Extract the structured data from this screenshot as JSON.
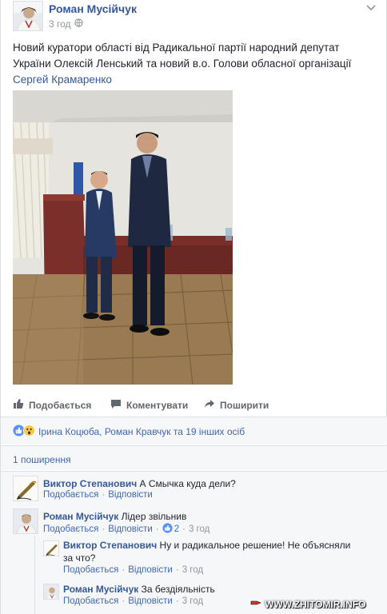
{
  "post": {
    "author": "Роман Мусійчук",
    "time": "3 год",
    "text_main": "Новий куратори області від Радикальної партії народний депутат України Олексій Ленський та новий в.о. Голови обласної організації ",
    "text_mention": "Сергей Крамаренко",
    "photo_icon": "photo-two-men-at-podium",
    "actions": {
      "like": "Подобається",
      "comment": "Коментувати",
      "share": "Поширити"
    },
    "reactions_text": "Ірина Коцюба, Роман Кравчук та 19 інших осіб",
    "reaction_icons": [
      "like-icon",
      "wow-icon"
    ],
    "shares_text": "1 поширення"
  },
  "comments": [
    {
      "author": "Виктор Степанович",
      "text": "А Смычка куда дели?",
      "like": "Подобається",
      "reply": "Відповісти",
      "sep": "·"
    },
    {
      "author": "Роман Мусійчук",
      "text": "Лідер звільнив",
      "like": "Подобається",
      "reply": "Відповісти",
      "reactions": "2",
      "time": "3 год",
      "sep": "·"
    }
  ],
  "replies": [
    {
      "author": "Виктор Степанович",
      "text": "Ну и радикальное решение! Не объясняли за что?",
      "like": "Подобається",
      "reply": "Відповісти",
      "time": "3 год",
      "sep": "·"
    },
    {
      "author": "Роман Мусійчук",
      "text": "За бездіяльність",
      "like": "Подобається",
      "reply": "Відповісти",
      "time": "3 год",
      "sep": "·"
    }
  ],
  "watermark": "WWW.ZHITOMIR.INFO",
  "colors": {
    "link": "#365899",
    "muted": "#90949c",
    "accent": "#4267b2",
    "border": "#dddfe2"
  }
}
